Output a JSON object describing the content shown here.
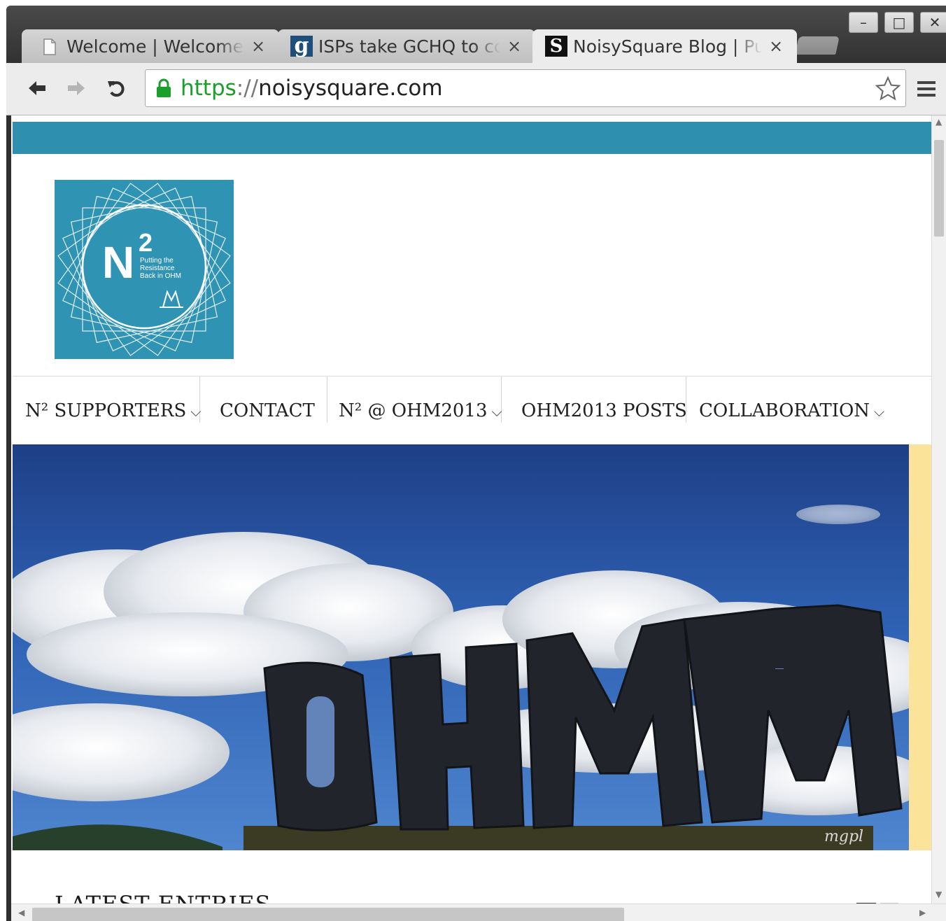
{
  "browser": {
    "tabs": [
      {
        "title": "Welcome | Welcome to",
        "favicon": "page-icon",
        "active": false
      },
      {
        "title": "ISPs take GCHQ to court",
        "favicon": "g",
        "active": false
      },
      {
        "title": "NoisySquare Blog | Putting the Resistance Back in OHM",
        "favicon": "S",
        "active": true
      }
    ],
    "url": {
      "scheme": "https",
      "separator": "://",
      "host": "noisysquare.com"
    },
    "window_controls": {
      "minimize": "–",
      "maximize": "□",
      "close": "✕"
    }
  },
  "site": {
    "logo": {
      "main": "N",
      "sup": "2",
      "tagline": "Putting the Resistance Back in OHM"
    },
    "nav": [
      {
        "label": "N² SUPPORTERS",
        "has_dropdown": true
      },
      {
        "label": "CONTACT",
        "has_dropdown": false
      },
      {
        "label": "N² @ OHM2013",
        "has_dropdown": true
      },
      {
        "label": "OHM2013 POSTS",
        "has_dropdown": false
      },
      {
        "label": "COLLABORATION",
        "has_dropdown": true
      }
    ],
    "hero": {
      "sign_text": "OHM",
      "watermark": "mgpl"
    },
    "latest_heading": "LATEST ENTRIES"
  },
  "colors": {
    "band": "#2f8fae",
    "logo_bg": "#2f93b3",
    "accent_side": "#fbe49a",
    "secure_green": "#1a9f2a"
  }
}
